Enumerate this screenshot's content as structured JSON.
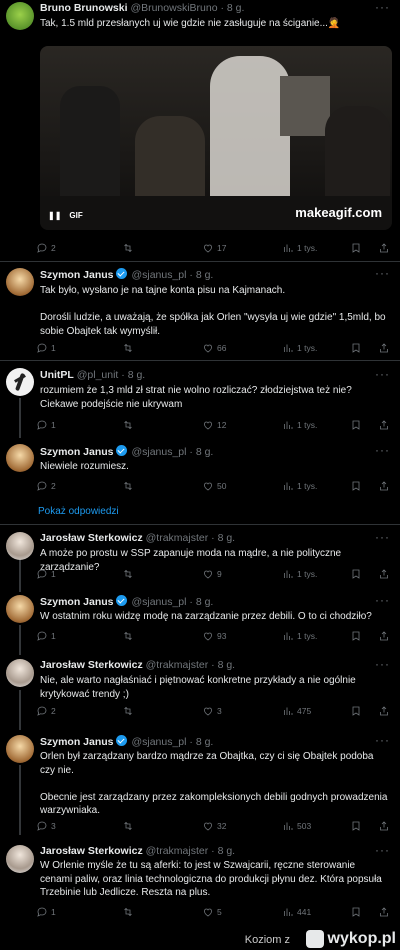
{
  "tweets": [
    {
      "name": "Bruno Brunowski",
      "handle": "@BrunowskiBruno",
      "time": "· 8 g.",
      "text": "Tak, 1.5 mld przesłanych uj wie gdzie nie zasługuje na ściganie...🤦",
      "replies": "2",
      "retweets": "",
      "likes": "17",
      "views": "1 tys."
    },
    {
      "name": "Szymon Janus",
      "handle": "@sjanus_pl",
      "time": "· 8 g.",
      "text": "Tak było, wysłano je na tajne konta pisu na Kajmanach.\n\nDorośli ludzie, a uważają, że spółka jak Orlen \"wysyła uj wie gdzie\" 1,5mld, bo sobie Obajtek tak wymyślił.",
      "replies": "1",
      "retweets": "",
      "likes": "66",
      "views": "1 tys."
    },
    {
      "name": "UnitPL",
      "handle": "@pl_unit",
      "time": "· 8 g.",
      "text": "rozumiem że 1,3 mld zł strat nie wolno rozliczać? złodziejstwa też nie? Ciekawe podejście nie ukrywam",
      "replies": "1",
      "retweets": "",
      "likes": "12",
      "views": "1 tys."
    },
    {
      "name": "Szymon Janus",
      "handle": "@sjanus_pl",
      "time": "· 8 g.",
      "text": "Niewiele rozumiesz.",
      "replies": "2",
      "retweets": "",
      "likes": "50",
      "views": "1 tys."
    },
    {
      "name": "Jarosław Sterkowicz",
      "handle": "@trakmajster",
      "time": "· 8 g.",
      "text": "A może po prostu w SSP zapanuje moda na mądre, a nie polityczne zarządzanie?",
      "replies": "1",
      "retweets": "",
      "likes": "9",
      "views": "1 tys."
    },
    {
      "name": "Szymon Janus",
      "handle": "@sjanus_pl",
      "time": "· 8 g.",
      "text": "W ostatnim roku widzę modę na zarządzanie przez debili. O to ci chodziło?",
      "replies": "1",
      "retweets": "",
      "likes": "93",
      "views": "1 tys."
    },
    {
      "name": "Jarosław Sterkowicz",
      "handle": "@trakmajster",
      "time": "· 8 g.",
      "text": "Nie, ale warto nagłaśniać i piętnować konkretne przykłady a nie ogólnie krytykować trendy ;)",
      "replies": "2",
      "retweets": "",
      "likes": "3",
      "views": "475"
    },
    {
      "name": "Szymon Janus",
      "handle": "@sjanus_pl",
      "time": "· 8 g.",
      "text": "Orlen był zarządzany bardzo mądrze za Obajtka, czy ci się Obajtek podoba czy nie.\n\nObecnie jest zarządzany przez zakompleksionych debili godnych prowadzenia warzywniaka.",
      "replies": "3",
      "retweets": "",
      "likes": "32",
      "views": "503"
    },
    {
      "name": "Jarosław Sterkowicz",
      "handle": "@trakmajster",
      "time": "· 8 g.",
      "text": "W Orlenie myśle że tu są aferki: to jest w Szwajcarii, ręczne sterowanie cenami paliw, oraz  linia technologiczna do produkcji płynu dez. Która popsuła Trzebinie lub Jedlicze. Reszta na plus.",
      "replies": "1",
      "retweets": "",
      "likes": "5",
      "views": "441"
    }
  ],
  "gif": {
    "label": "GIF",
    "watermark": "makeagif.com"
  },
  "show_replies": "Pokaż odpowiedzi",
  "footer": {
    "user": "Koziom",
    "sep": "z",
    "site": "wykop.pl"
  },
  "colors": {
    "accent": "#1d9bf0",
    "muted": "#71767b",
    "bg": "#000000",
    "border": "#2f3336"
  }
}
